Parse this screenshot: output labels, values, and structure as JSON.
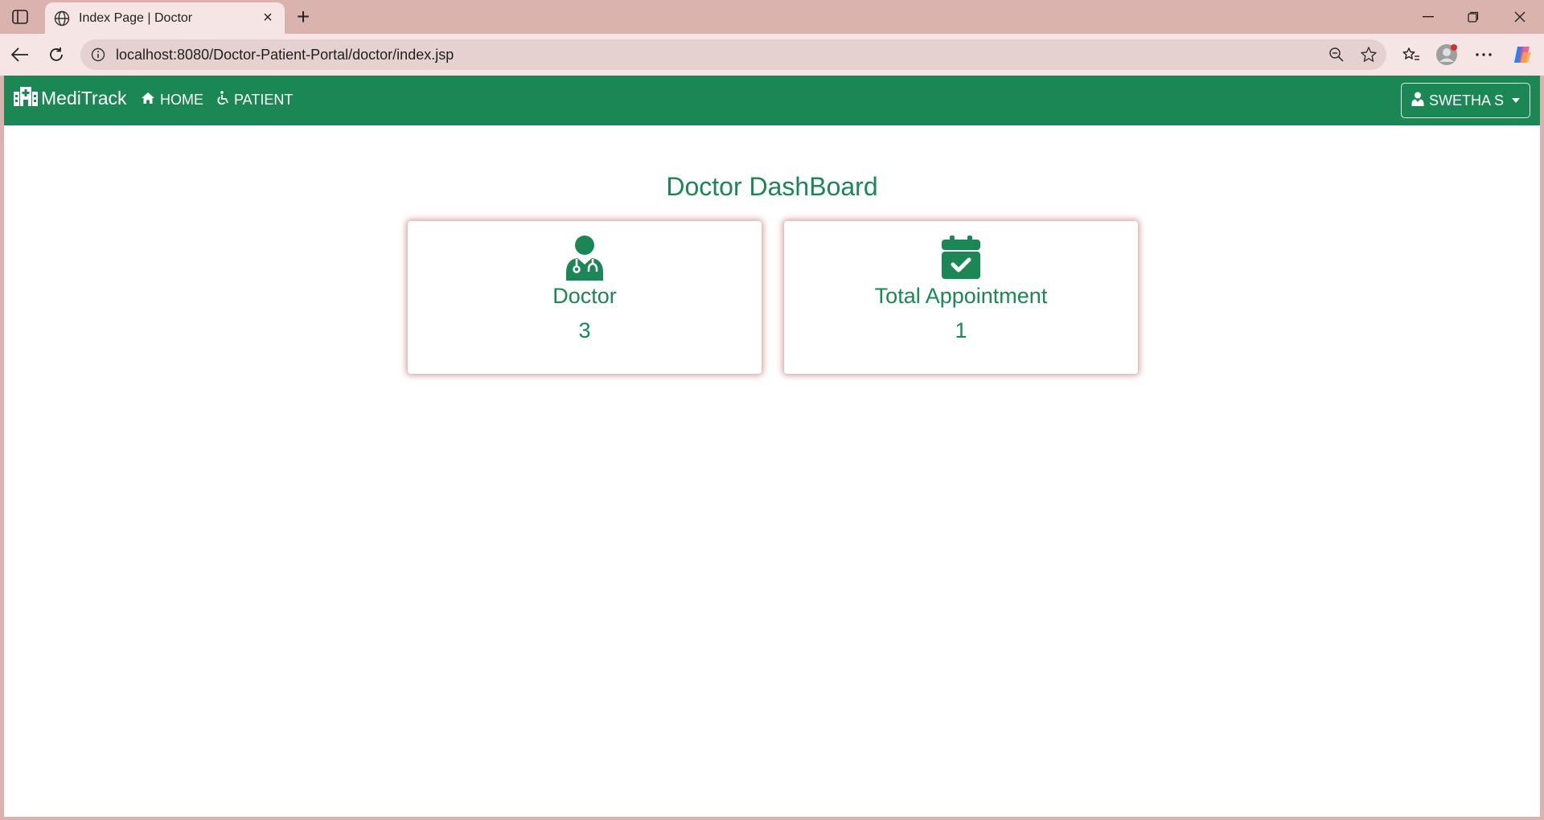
{
  "browser": {
    "tab_title": "Index Page | Doctor",
    "url": "localhost:8080/Doctor-Patient-Portal/doctor/index.jsp"
  },
  "navbar": {
    "brand": "MediTrack",
    "links": [
      {
        "label": "HOME",
        "icon": "home-icon"
      },
      {
        "label": "PATIENT",
        "icon": "wheelchair-icon"
      }
    ],
    "user": {
      "label": "SWETHA S",
      "icon": "user-doctor-icon"
    }
  },
  "dashboard": {
    "title": "Doctor DashBoard",
    "cards": [
      {
        "label": "Doctor",
        "value": "3",
        "icon": "doctor-icon"
      },
      {
        "label": "Total Appointment",
        "value": "1",
        "icon": "calendar-check-icon"
      }
    ]
  },
  "colors": {
    "primary": "#1a8754",
    "chrome": "#dbb3ae",
    "card_shadow": "#a02828"
  }
}
